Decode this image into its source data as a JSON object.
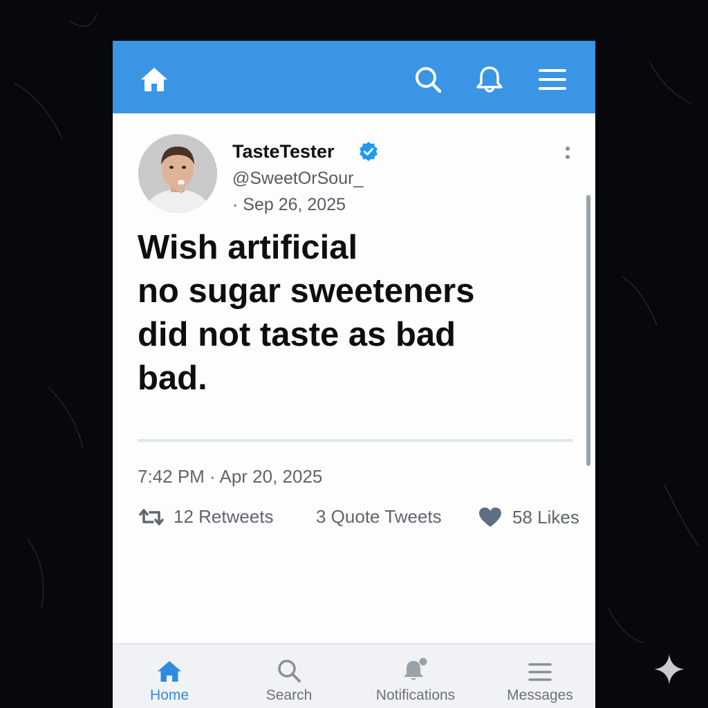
{
  "colors": {
    "accent": "#3b95e5",
    "verified": "#1d9bf0",
    "text_primary": "#111111",
    "text_secondary": "#5f656c",
    "heart": "#5f6e80"
  },
  "top_nav": {
    "home_icon": "home-icon",
    "search_icon": "search-icon",
    "notifications_icon": "bell-icon",
    "menu_icon": "hamburger-menu-icon"
  },
  "tweet": {
    "display_name": "TasteTester",
    "handle": "@SweetOrSour_",
    "date": "· Sep 26, 2025",
    "text": "Wish artificial\nno sugar sweeteners\ndid not  taste as bad\nbad.",
    "timestamp": "7:42 PM · Apr 20, 2025",
    "retweets": "12 Retweets",
    "quote_tweets": "3 Quote Tweets",
    "likes": "58 Likes"
  },
  "bottom_nav": {
    "items": [
      {
        "label": "Home",
        "icon": "home-icon",
        "active": true
      },
      {
        "label": "Search",
        "icon": "search-icon",
        "active": false
      },
      {
        "label": "Notifications",
        "icon": "bell-icon",
        "active": false
      },
      {
        "label": "Messages",
        "icon": "hamburger-menu-icon",
        "active": false
      }
    ]
  }
}
